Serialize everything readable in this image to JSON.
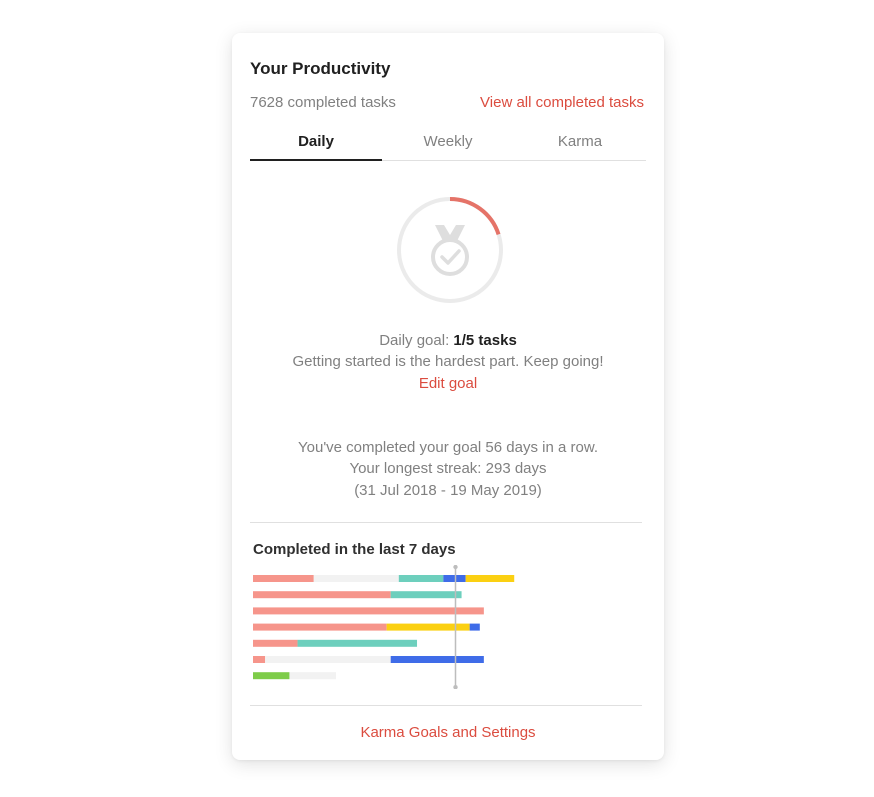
{
  "header": {
    "title": "Your Productivity",
    "completed_count": "7628 completed tasks",
    "view_all_link": "View all completed tasks"
  },
  "tabs": [
    {
      "label": "Daily",
      "active": true
    },
    {
      "label": "Weekly",
      "active": false
    },
    {
      "label": "Karma",
      "active": false
    }
  ],
  "goal": {
    "progress_fraction": 0.2,
    "label_prefix": "Daily goal: ",
    "value": "1/5 tasks",
    "message": "Getting started is the hardest part. Keep going!",
    "edit_link": "Edit goal"
  },
  "streak": {
    "current": "You've completed your goal 56 days in a row.",
    "longest": "Your longest streak: 293 days",
    "range": "(31 Jul 2018 - 19 May 2019)"
  },
  "chart_section": {
    "title": "Completed in the last 7 days"
  },
  "chart_data": {
    "type": "bar",
    "orientation": "horizontal",
    "stacked": true,
    "goal": 5,
    "segment_colors": {
      "coral": "#f6958b",
      "teal": "#6dcfbd",
      "blue": "#3f6ce8",
      "yellow": "#fbd012",
      "green": "#7ecc49",
      "remainder": "#f2f2f2"
    },
    "rows": [
      {
        "segments": [
          {
            "color": "coral",
            "value": 1.5
          },
          {
            "color": "remainder",
            "value": 2.1
          },
          {
            "color": "teal",
            "value": 1.1
          },
          {
            "color": "blue",
            "value": 0.55
          },
          {
            "color": "yellow",
            "value": 1.2
          }
        ]
      },
      {
        "segments": [
          {
            "color": "coral",
            "value": 3.4
          },
          {
            "color": "teal",
            "value": 1.75
          }
        ]
      },
      {
        "segments": [
          {
            "color": "coral",
            "value": 5.7
          }
        ]
      },
      {
        "segments": [
          {
            "color": "coral",
            "value": 3.3
          },
          {
            "color": "yellow",
            "value": 2.05
          },
          {
            "color": "blue",
            "value": 0.25
          }
        ]
      },
      {
        "segments": [
          {
            "color": "coral",
            "value": 1.1
          },
          {
            "color": "teal",
            "value": 2.95
          }
        ]
      },
      {
        "segments": [
          {
            "color": "coral",
            "value": 0.3
          },
          {
            "color": "remainder",
            "value": 3.1
          },
          {
            "color": "blue",
            "value": 2.3
          }
        ]
      },
      {
        "segments": [
          {
            "color": "green",
            "value": 0.9
          },
          {
            "color": "remainder",
            "value": 1.15
          }
        ]
      }
    ]
  },
  "footer": {
    "settings_link": "Karma Goals and Settings"
  },
  "colors": {
    "accent": "#db4c3f",
    "progress_ring": "#e57368",
    "ring_track": "#ebebeb",
    "medal": "#dedede"
  }
}
